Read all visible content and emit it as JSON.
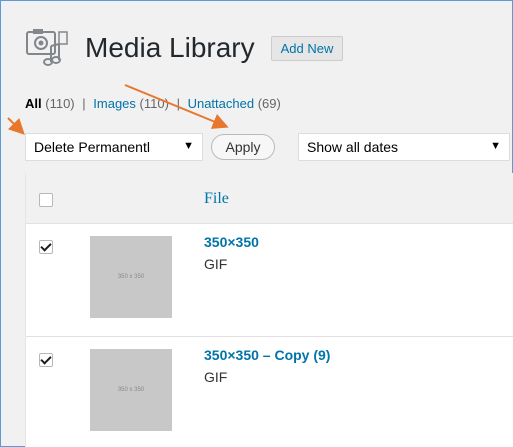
{
  "header": {
    "title": "Media Library",
    "add_new_label": "Add New"
  },
  "filters": {
    "all_label": "All",
    "all_count": "(110)",
    "images_label": "Images",
    "images_count": "(110)",
    "unattached_label": "Unattached",
    "unattached_count": "(69)",
    "separator": "|"
  },
  "bulk_actions": {
    "selected": "Delete Permanentl",
    "apply_label": "Apply"
  },
  "date_filter": {
    "selected": "Show all dates"
  },
  "table": {
    "column_file": "File",
    "rows": [
      {
        "title": "350×350",
        "type": "GIF",
        "thumb_text": "350 x 350",
        "checked": true
      },
      {
        "title": "350×350 – Copy (9)",
        "type": "GIF",
        "thumb_text": "350 x 350",
        "checked": true
      }
    ]
  },
  "icons": {
    "media": "media-library-icon",
    "dropdown": "chevron-down-icon"
  },
  "colors": {
    "link": "#0073aa",
    "annotation_arrow": "#e8772e",
    "frame": "#5b9bd5"
  }
}
